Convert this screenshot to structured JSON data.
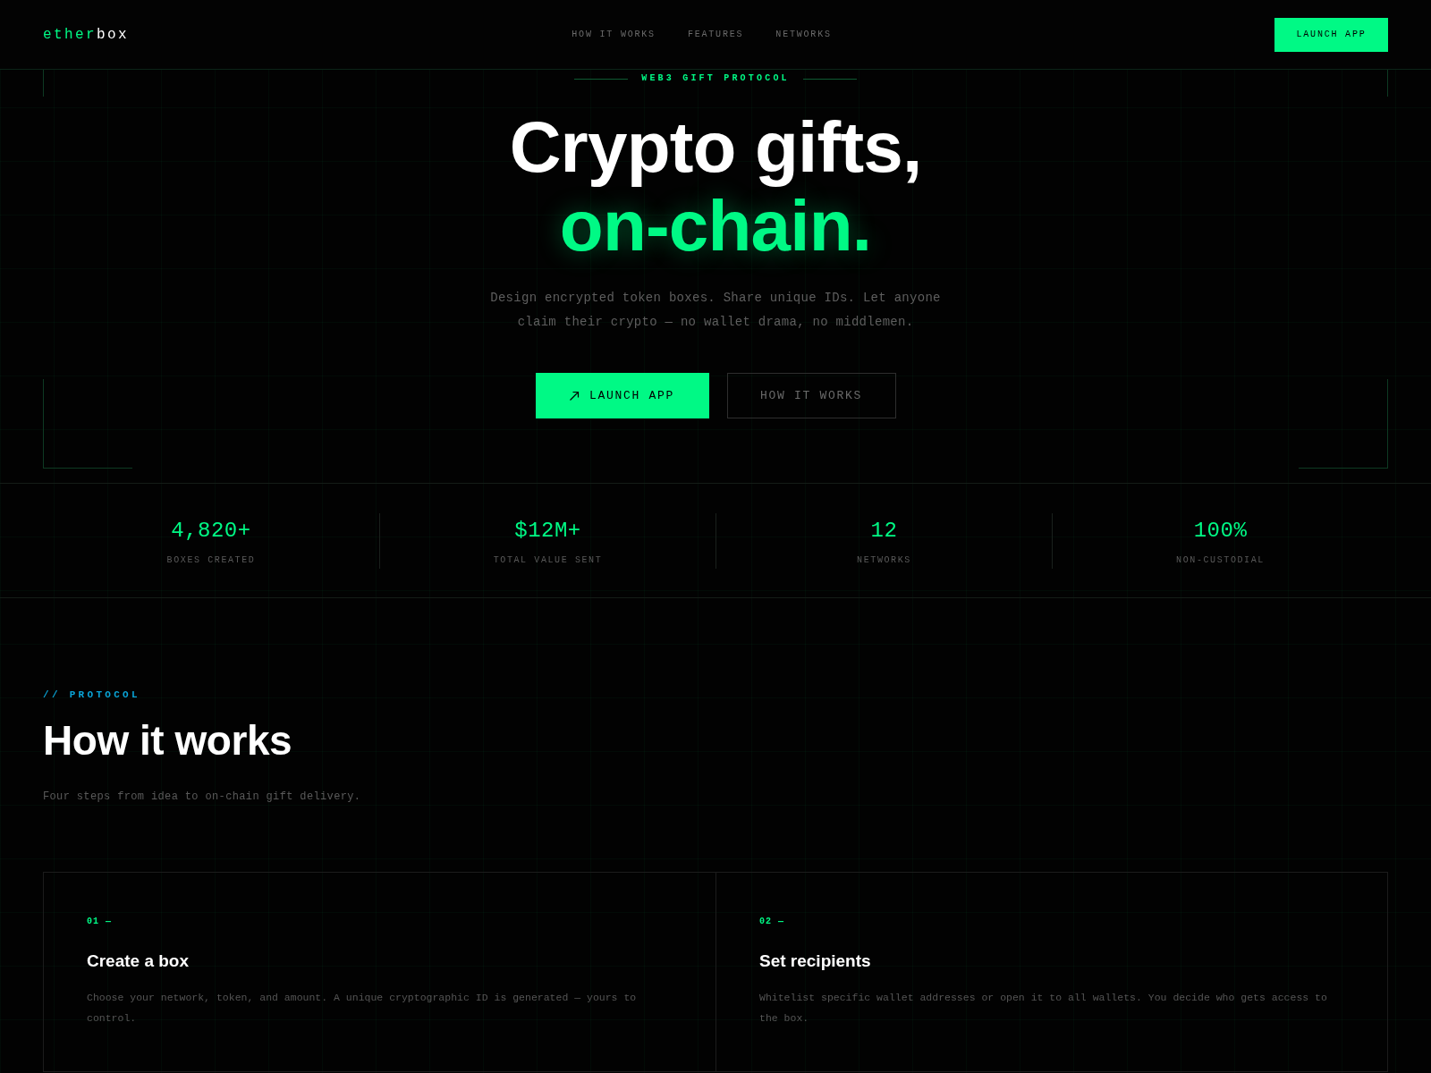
{
  "nav": {
    "logo": {
      "accent": "ether",
      "rest": "box"
    },
    "links": [
      {
        "label": "HOW IT WORKS"
      },
      {
        "label": "FEATURES"
      },
      {
        "label": "NETWORKS"
      }
    ],
    "cta": "LAUNCH APP"
  },
  "hero": {
    "eyebrow": "WEB3 GIFT PROTOCOL",
    "title": "Crypto gifts,",
    "title_accent": "on-chain.",
    "subtitle": "Design encrypted token boxes. Share unique IDs. Let anyone claim their crypto — no wallet drama, no middlemen.",
    "buttons": [
      {
        "label": "LAUNCH APP",
        "kind": "primary"
      },
      {
        "label": "HOW IT WORKS",
        "kind": "secondary"
      }
    ]
  },
  "stats": [
    {
      "value": "4,820+",
      "label": "BOXES CREATED"
    },
    {
      "value": "$12M+",
      "label": "TOTAL VALUE SENT"
    },
    {
      "value": "12",
      "label": "NETWORKS"
    },
    {
      "value": "100%",
      "label": "NON-CUSTODIAL"
    }
  ],
  "protocol": {
    "eyebrow": "// PROTOCOL",
    "title": "How it works",
    "subtitle": "Four steps from idea to on-chain gift delivery.",
    "steps": [
      {
        "number": "01 —",
        "title": "Create a box",
        "description": "Choose your network, token, and amount. A unique cryptographic ID is generated — yours to control."
      },
      {
        "number": "02 —",
        "title": "Set recipients",
        "description": "Whitelist specific wallet addresses or open it to all wallets. You decide who gets access to the box."
      }
    ]
  }
}
